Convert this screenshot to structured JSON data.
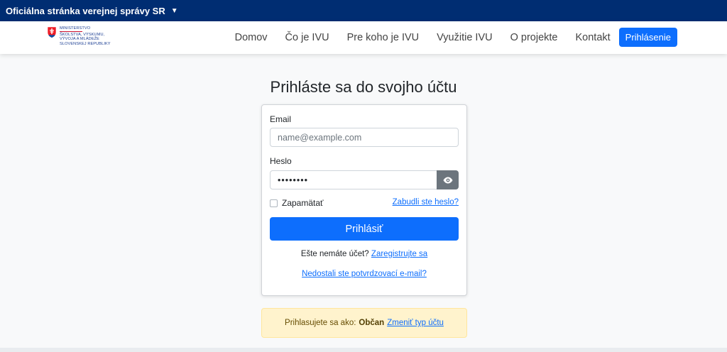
{
  "gov_bar": {
    "label": "Oficiálna stránka verejnej správy SR",
    "caret": "▼"
  },
  "logo": {
    "line1": "Ministerstvo",
    "line2": "školstva, výskumu,",
    "line3": "vývoja a mládeže",
    "line4": "Slovenskej republiky"
  },
  "nav": {
    "items": [
      "Domov",
      "Čo je IVU",
      "Pre koho je IVU",
      "Využitie IVU",
      "O projekte",
      "Kontakt"
    ],
    "login_label": "Prihlásenie"
  },
  "page_title": "Prihláste sa do svojho účtu",
  "form": {
    "email_label": "Email",
    "email_placeholder": "name@example.com",
    "password_label": "Heslo",
    "password_value": "••••••••",
    "remember_label": "Zapamätať",
    "forgot_link": "Zabudli ste heslo?",
    "submit_label": "Prihlásiť",
    "register_text": "Ešte nemáte účet?",
    "register_link": "Zaregistrujte sa",
    "resend_link": "Nedostali ste potvrdzovací e-mail?"
  },
  "alert": {
    "prefix": "Prihlasujete sa ako:",
    "account_type": "Občan",
    "change_link": "Zmeniť typ účtu"
  },
  "colors": {
    "gov_bar": "#002d72",
    "primary": "#0d6efd",
    "alert_bg": "#fff3cd"
  }
}
